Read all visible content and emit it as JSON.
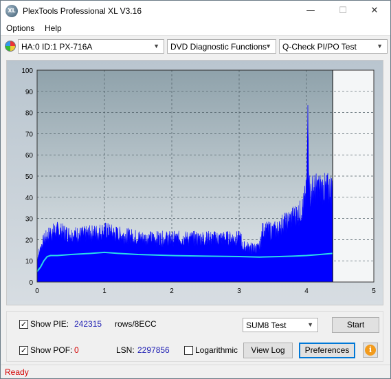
{
  "window": {
    "title": "PlexTools Professional XL V3.16",
    "icon_text": "XL",
    "minimize": "—",
    "maximize": "☐",
    "close": "✕"
  },
  "menu": [
    "Options",
    "Help"
  ],
  "toolbar": {
    "drive": "HA:0 ID:1  PX-716A",
    "function": "DVD Diagnostic Functions",
    "test": "Q-Check PI/PO Test"
  },
  "chart_data": {
    "type": "area",
    "x_ticks": [
      "0",
      "1",
      "2",
      "3",
      "4",
      "5"
    ],
    "y_ticks": [
      "0",
      "10",
      "20",
      "30",
      "40",
      "50",
      "60",
      "70",
      "80",
      "90",
      "100"
    ],
    "xlim": [
      0,
      5
    ],
    "ylim": [
      0,
      100
    ],
    "grid": true,
    "end_marker_x": 4.39,
    "series": [
      {
        "color": "#0000ff",
        "x": [
          0,
          0.05,
          0.1,
          0.2,
          0.3,
          0.5,
          0.7,
          0.9,
          1.0,
          1.2,
          1.4,
          1.6,
          1.8,
          2.0,
          2.2,
          2.4,
          2.6,
          2.8,
          3.0,
          3.03,
          3.04,
          3.2,
          3.3,
          3.35,
          3.5,
          3.6,
          3.65,
          3.7,
          3.8,
          3.9,
          3.95,
          4.0,
          4.02,
          4.05,
          4.1,
          4.2,
          4.3,
          4.39
        ],
        "y": [
          12,
          17,
          21,
          25,
          26,
          24,
          24,
          25,
          26,
          24,
          23,
          22,
          22,
          22,
          22,
          22,
          22,
          22,
          22,
          22,
          18,
          17,
          17,
          26,
          26,
          27,
          30,
          30,
          33,
          35,
          38,
          45,
          82,
          45,
          47,
          47,
          47,
          47
        ]
      },
      {
        "color": "#2ad9e8",
        "x": [
          0,
          0.05,
          0.1,
          0.15,
          0.2,
          0.3,
          0.5,
          0.8,
          1.0,
          1.2,
          1.5,
          2.0,
          2.5,
          3.0,
          3.3,
          3.6,
          3.8,
          4.0,
          4.2,
          4.39
        ],
        "y": [
          5,
          7,
          10,
          12,
          12.5,
          12.5,
          13,
          13.5,
          14,
          13.5,
          13,
          12.5,
          12.2,
          12,
          11.8,
          12,
          12.2,
          12.5,
          13,
          13.5
        ]
      }
    ]
  },
  "bottom": {
    "show_pie_label": "Show PIE:",
    "pie_value": "242315",
    "pie_unit": "rows/8ECC",
    "show_pof_label": "Show POF:",
    "pof_value": "0",
    "lsn_label": "LSN:",
    "lsn_value": "2297856",
    "log_label": "Logarithmic",
    "test_select": "SUM8 Test",
    "start_label": "Start",
    "view_log_label": "View Log",
    "prefs_label": "Preferences",
    "info_symbol": "i",
    "pie_color": "#1f1fb3",
    "pof_color": "#d40000"
  },
  "status": {
    "text": "Ready",
    "color": "#d40000"
  }
}
